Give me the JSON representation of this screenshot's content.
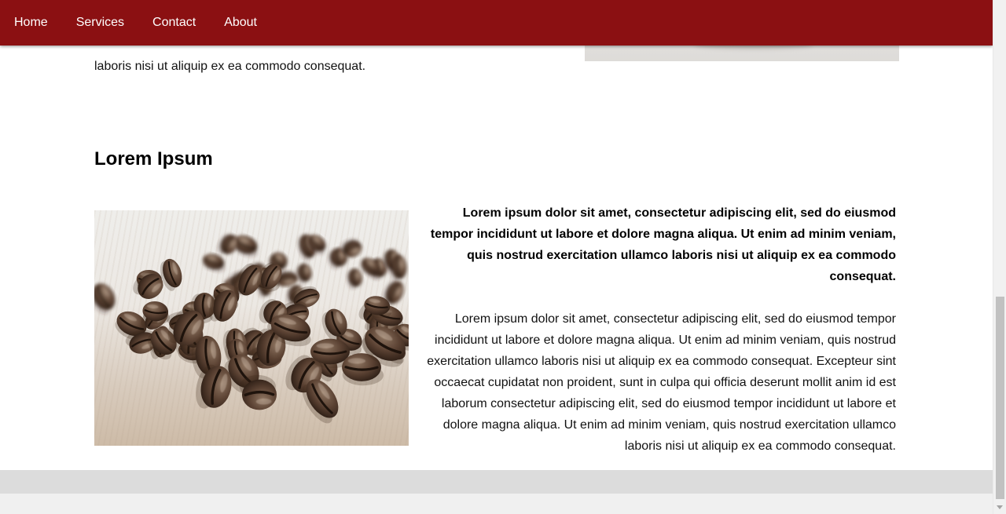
{
  "nav": {
    "items": [
      {
        "label": "Home"
      },
      {
        "label": "Services"
      },
      {
        "label": "Contact"
      },
      {
        "label": "About"
      }
    ]
  },
  "previous_section": {
    "text_tail": "laboris nisi ut aliquip ex ea commodo consequat."
  },
  "section": {
    "title": "Lorem Ipsum",
    "image_name": "coffee-beans-image",
    "lead": "Lorem ipsum dolor sit amet, consectetur adipiscing elit, sed do eiusmod tempor incididunt ut labore et dolore magna aliqua. Ut enim ad minim veniam, quis nostrud exercitation ullamco laboris nisi ut aliquip ex ea commodo consequat.",
    "body": "Lorem ipsum dolor sit amet, consectetur adipiscing elit, sed do eiusmod tempor incididunt ut labore et dolore magna aliqua. Ut enim ad minim veniam, quis nostrud exercitation ullamco laboris nisi ut aliquip ex ea commodo consequat. Excepteur sint occaecat cupidatat non proident, sunt in culpa qui officia deserunt mollit anim id est laborum consectetur adipiscing elit, sed do eiusmod tempor incididunt ut labore et dolore magna aliqua. Ut enim ad minim veniam, quis nostrud exercitation ullamco laboris nisi ut aliquip ex ea commodo consequat."
  },
  "colors": {
    "nav_background": "#8b1012",
    "nav_text": "#ffffff",
    "footer_bar": "#dcdcdc"
  }
}
